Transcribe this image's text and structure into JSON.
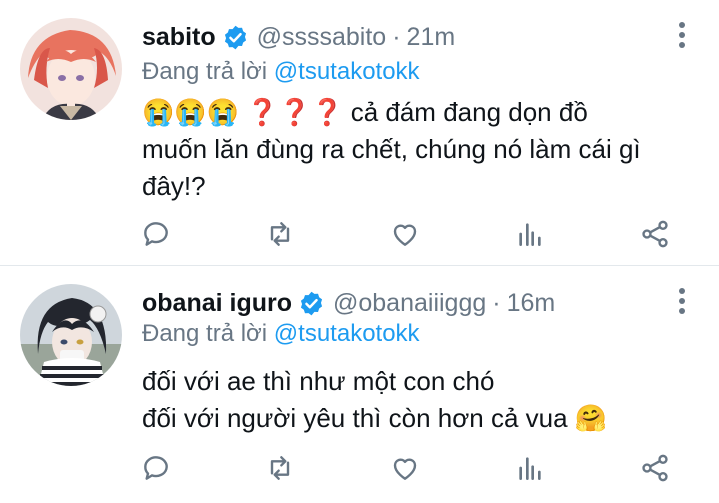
{
  "colors": {
    "accent": "#1d9bf0",
    "secondary_text": "#687684",
    "primary_text": "#0f1419",
    "divider": "#e3e8ec"
  },
  "tweets": [
    {
      "name": "sabito",
      "verified": true,
      "handle": "@ssssabito",
      "separator": "·",
      "time": "21m",
      "replying_prefix": "Đang trả lời",
      "replying_to": "@tsutakotokk",
      "emojis": "😭😭😭 ❓❓❓",
      "text_lines": [
        "cả đám đang dọn đồ",
        "muốn lăn đùng ra chết, chúng nó làm cái gì",
        "đây!?"
      ],
      "actions": [
        "reply-icon",
        "retweet-icon",
        "like-icon",
        "analytics-icon",
        "share-icon"
      ]
    },
    {
      "name": "obanai iguro",
      "verified": true,
      "handle": "@obanaiiiggg",
      "separator": "·",
      "time": "16m",
      "replying_prefix": "Đang trả lời",
      "replying_to": "@tsutakotokk",
      "text_lines": [
        "đối với ae thì như một con chó",
        "đối với người yêu thì còn hơn cả vua"
      ],
      "trailing_emoji": "🤗",
      "actions": [
        "reply-icon",
        "retweet-icon",
        "like-icon",
        "analytics-icon",
        "share-icon"
      ]
    }
  ]
}
